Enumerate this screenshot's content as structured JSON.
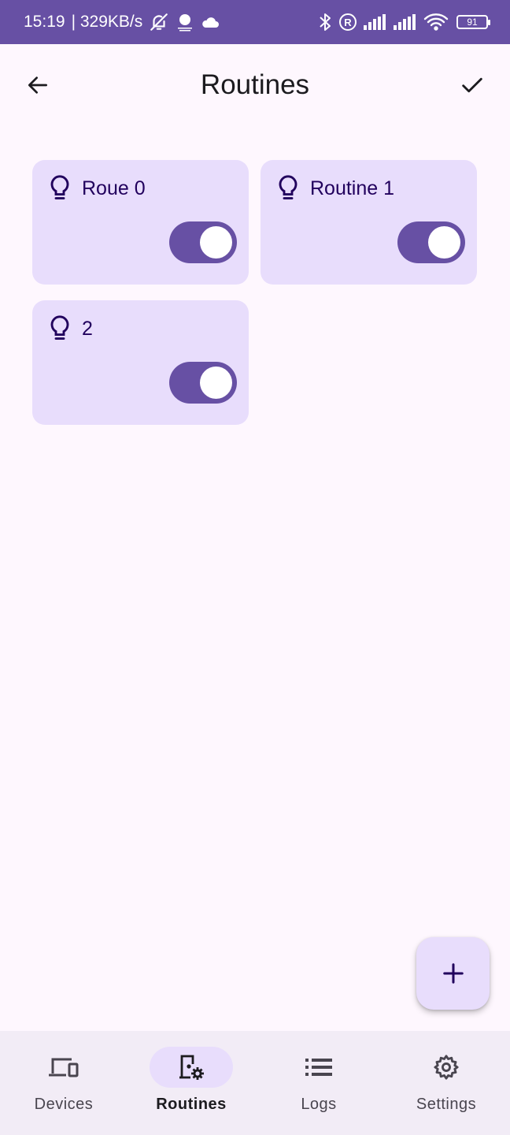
{
  "status_bar": {
    "time": "15:19",
    "speed": "| 329KB/s",
    "battery": "91",
    "icons": [
      "notifications-off-icon",
      "weather-icon",
      "cloud-icon",
      "bluetooth-icon",
      "registered-icon",
      "signal-icon",
      "signal-icon",
      "wifi-icon",
      "battery-icon"
    ]
  },
  "app_bar": {
    "title": "Routines",
    "back_icon": "arrow-back-icon",
    "confirm_icon": "check-icon"
  },
  "routines": [
    {
      "label": "Roue 0",
      "icon": "lightbulb-icon",
      "enabled": true
    },
    {
      "label": "Routine 1",
      "icon": "lightbulb-icon",
      "enabled": true
    },
    {
      "label": "2",
      "icon": "lightbulb-icon",
      "enabled": true
    }
  ],
  "fab": {
    "icon": "add-icon"
  },
  "nav": {
    "items": [
      {
        "label": "Devices",
        "icon": "devices-icon",
        "active": false
      },
      {
        "label": "Routines",
        "icon": "routines-icon",
        "active": true
      },
      {
        "label": "Logs",
        "icon": "list-icon",
        "active": false
      },
      {
        "label": "Settings",
        "icon": "gear-icon",
        "active": false
      }
    ]
  },
  "colors": {
    "primary": "#6750a4",
    "card": "#e8ddfc",
    "background": "#fef7fe",
    "nav_background": "#f2ecf6",
    "on_card": "#21005d"
  }
}
